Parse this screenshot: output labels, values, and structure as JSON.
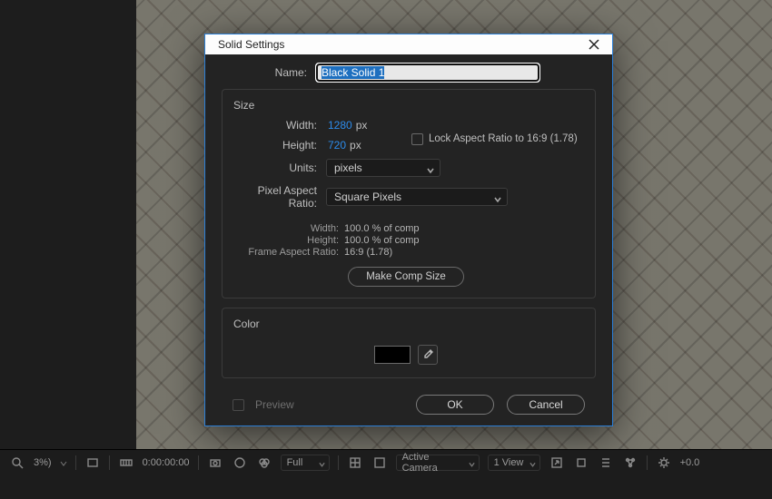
{
  "dialog": {
    "title": "Solid Settings",
    "name_label": "Name:",
    "name_value": "Black Solid 1",
    "size_group": "Size",
    "width_label": "Width:",
    "width_value": "1280",
    "width_unit": "px",
    "height_label": "Height:",
    "height_value": "720",
    "height_unit": "px",
    "lock_aspect": "Lock Aspect Ratio to 16:9 (1.78)",
    "units_label": "Units:",
    "units_value": "pixels",
    "par_label": "Pixel Aspect Ratio:",
    "par_value": "Square Pixels",
    "info_width_label": "Width:",
    "info_width_value": "100.0 % of comp",
    "info_height_label": "Height:",
    "info_height_value": "100.0 % of comp",
    "info_far_label": "Frame Aspect Ratio:",
    "info_far_value": "16:9 (1.78)",
    "make_comp": "Make Comp Size",
    "color_group": "Color",
    "preview_label": "Preview",
    "ok": "OK",
    "cancel": "Cancel",
    "swatch_color": "#000000"
  },
  "bottombar": {
    "zoom_suffix": "3%)",
    "timecode": "0:00:00:00",
    "quality": "Full",
    "camera": "Active Camera",
    "views": "1 View",
    "exposure": "+0.0"
  }
}
